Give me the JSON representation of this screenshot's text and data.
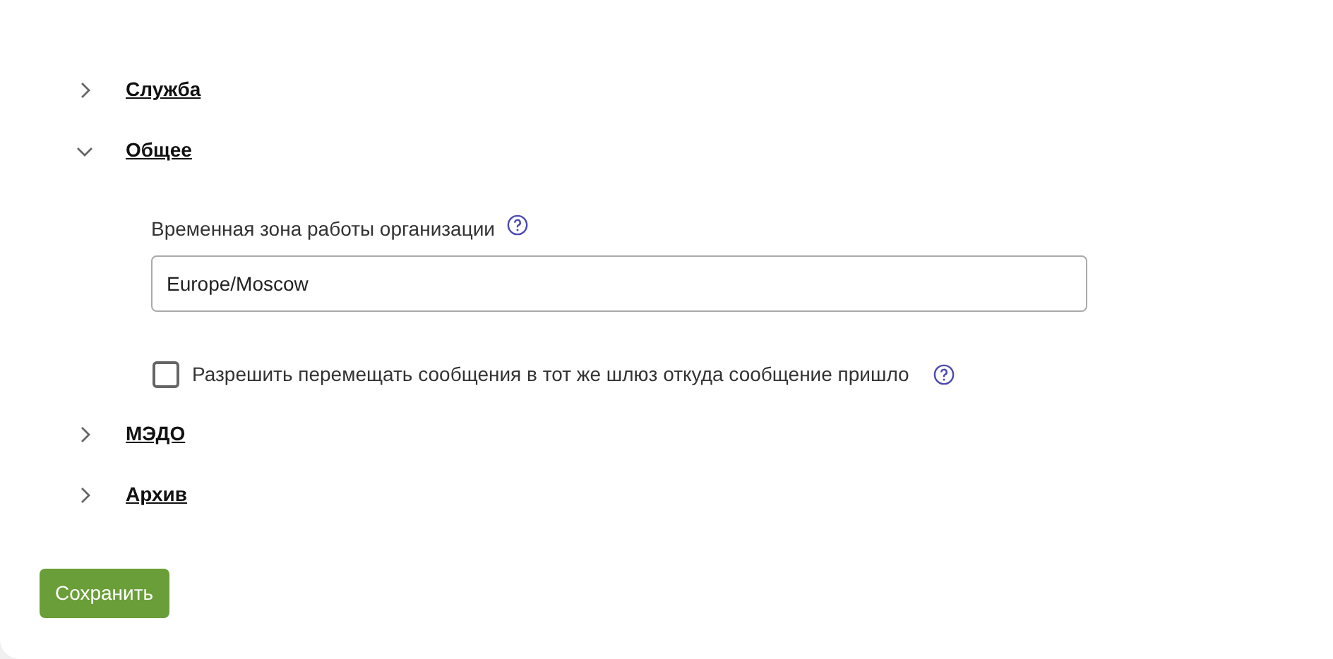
{
  "sections": [
    {
      "title": "Служба",
      "expanded": false
    },
    {
      "title": "Общее",
      "expanded": true,
      "fields": [
        {
          "kind": "input",
          "label": "Временная зона работы организации",
          "value": "Europe/Moscow"
        },
        {
          "kind": "checkbox",
          "label": "Разрешить перемещать сообщения в тот же шлюз откуда сообщение пришло",
          "checked": false
        }
      ]
    },
    {
      "title": "МЭДО",
      "expanded": false
    },
    {
      "title": "Архив",
      "expanded": false
    }
  ],
  "save_button": "Сохранить"
}
